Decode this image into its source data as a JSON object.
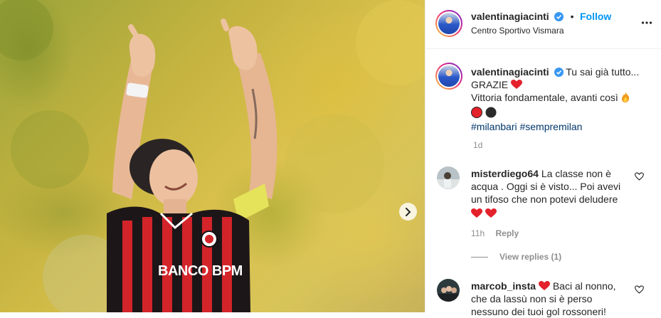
{
  "post": {
    "author": "valentinagiacinti",
    "follow_label": "Follow",
    "location": "Centro Sportivo Vismara",
    "time_ago": "1d",
    "caption": {
      "line1": "Tu sai già tutto...",
      "line2": "GRAZIE",
      "line3": "Vittoria fondamentale, avanti così",
      "hashtag1": "#milanbari",
      "hashtag2": "#sempremilan"
    },
    "photo_text": "BANCO BPM"
  },
  "comments": [
    {
      "user": "misterdiego64",
      "text": "La classe non è acqua . Oggi si è visto... Poi avevi un tifoso che non potevi deludere",
      "time": "11h",
      "reply_label": "Reply",
      "view_replies": "View replies (1)"
    },
    {
      "user": "marcob_insta",
      "text": "Baci al nonno, che da lassù non si è perso nessuno dei tuoi gol rossoneri!"
    }
  ],
  "colors": {
    "accent": "#0095f6",
    "hashtag": "#00376b",
    "heart": "#ed4956",
    "muted": "#8e8e8e"
  },
  "icons": [
    "verified-badge-icon",
    "more-options-icon",
    "heart-emoji-icon",
    "fire-emoji-icon",
    "red-circle-icon",
    "black-circle-icon",
    "like-heart-icon",
    "chevron-right-icon"
  ]
}
